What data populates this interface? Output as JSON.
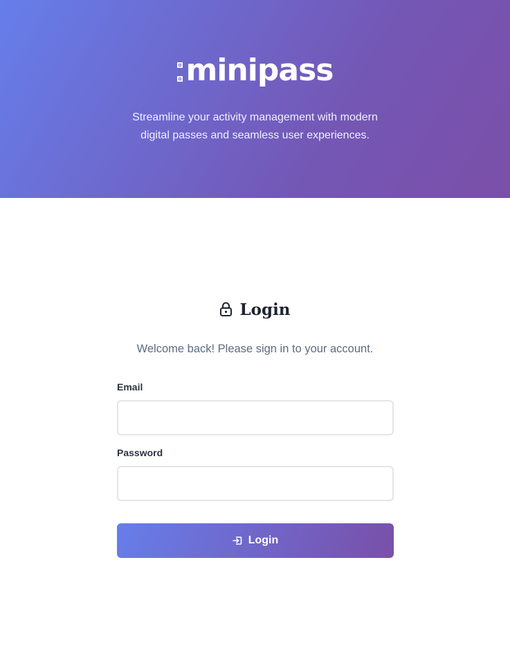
{
  "header": {
    "brand": "minipass",
    "tagline_line1": "Streamline your activity management with modern",
    "tagline_line2": "digital passes and seamless user experiences."
  },
  "login": {
    "title": "Login",
    "subtitle": "Welcome back! Please sign in to your account.",
    "email_label": "Email",
    "email_value": "",
    "password_label": "Password",
    "password_value": "",
    "submit_label": "Login",
    "title_icon": "lock-icon",
    "submit_icon": "sign-in-icon"
  },
  "colors": {
    "gradient_start": "#667eea",
    "gradient_end": "#764ba2",
    "text_dark": "#1f2430",
    "text_muted": "#5c6b7f"
  }
}
